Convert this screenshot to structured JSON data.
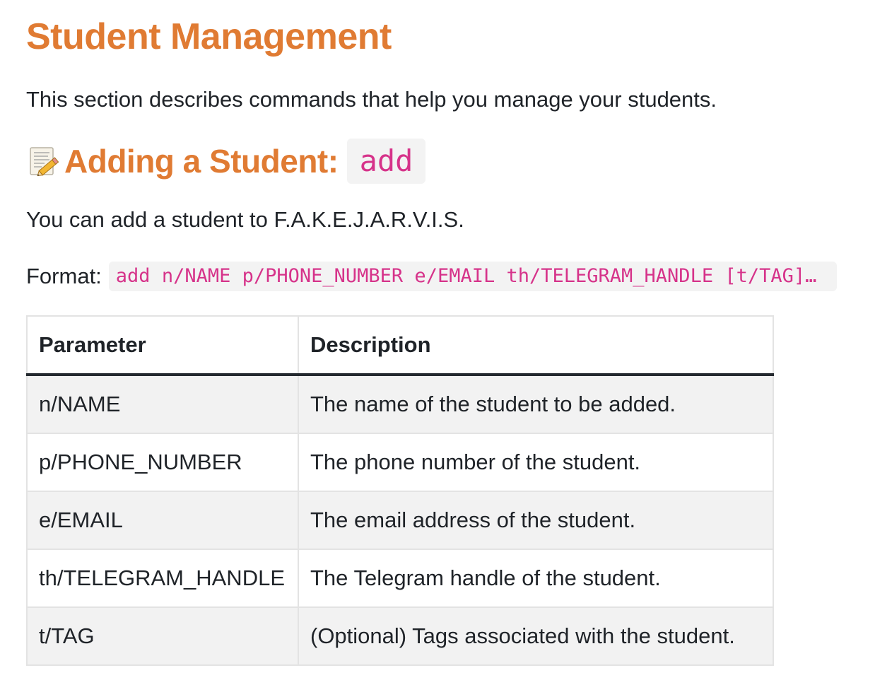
{
  "page": {
    "title": "Student Management",
    "intro": "This section describes commands that help you manage your students."
  },
  "section": {
    "icon": "memo-icon",
    "heading": "Adding a Student:",
    "command": "add",
    "lead": "You can add a student to F.A.K.E.J.A.R.V.I.S.",
    "format_label": "Format:",
    "format_code": "add n/NAME p/PHONE_NUMBER e/EMAIL th/TELEGRAM_HANDLE [t/TAG]…"
  },
  "table": {
    "headers": [
      "Parameter",
      "Description"
    ],
    "rows": [
      {
        "parameter": "n/NAME",
        "description": "The name of the student to be added."
      },
      {
        "parameter": "p/PHONE_NUMBER",
        "description": "The phone number of the student."
      },
      {
        "parameter": "e/EMAIL",
        "description": "The email address of the student."
      },
      {
        "parameter": "th/TELEGRAM_HANDLE",
        "description": "The Telegram handle of the student."
      },
      {
        "parameter": "t/TAG",
        "description": "(Optional) Tags associated with the student."
      }
    ]
  },
  "colors": {
    "heading": "#e07b33",
    "code": "#d6338a",
    "code_bg": "#f3f3f3"
  }
}
